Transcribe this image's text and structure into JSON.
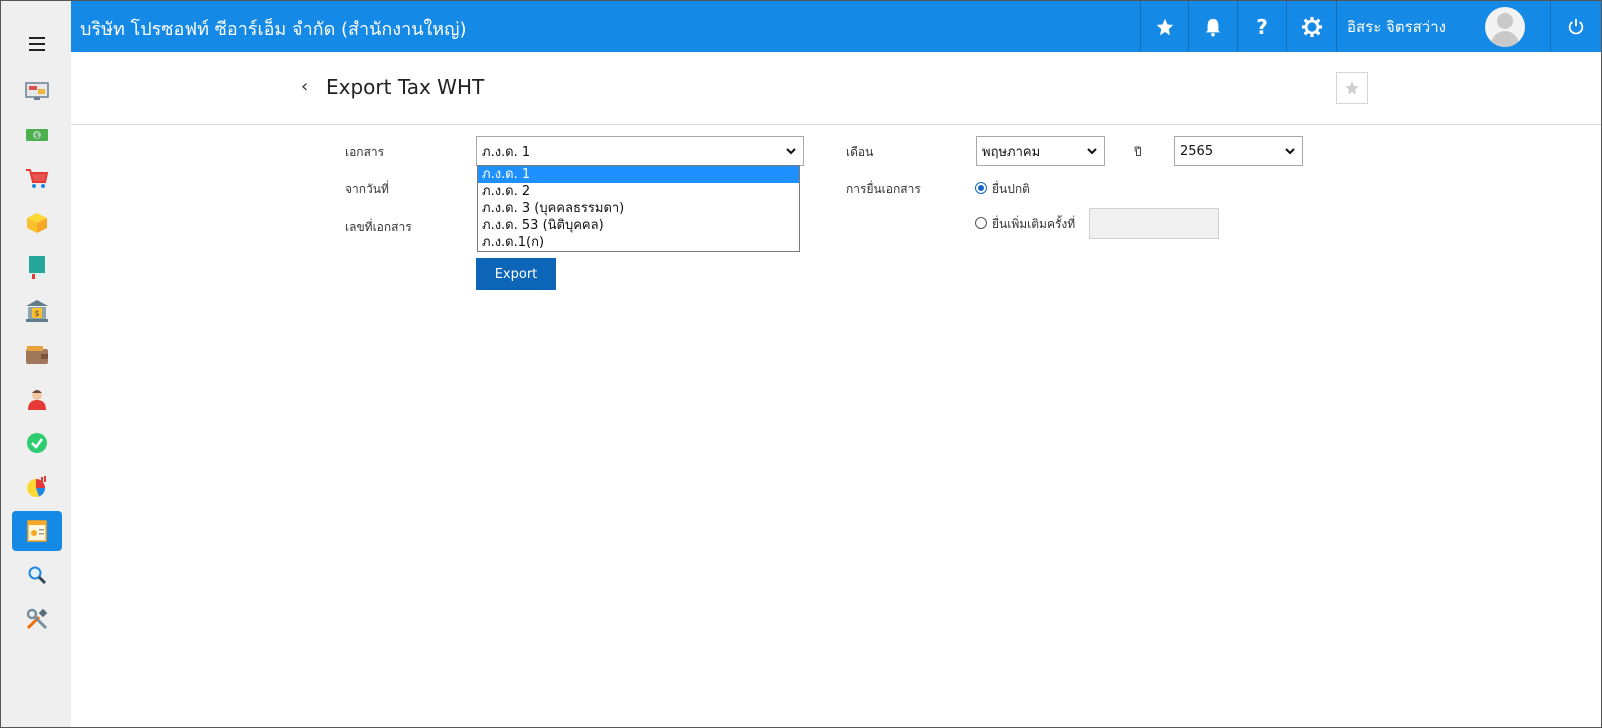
{
  "header": {
    "company": "บริษัท โปรซอฟท์ ซีอาร์เอ็ม จำกัด (สำนักงานใหญ่)",
    "user_name": "อิสระ จิตรสว่าง",
    "icons": [
      "star-icon",
      "bell-icon",
      "help-icon",
      "gear-icon",
      "avatar",
      "power-icon"
    ],
    "help_glyph": "?"
  },
  "sidebar": {
    "items": [
      {
        "icon": "monitor-icon"
      },
      {
        "icon": "money-icon"
      },
      {
        "icon": "cart-icon"
      },
      {
        "icon": "box-icon"
      },
      {
        "icon": "book-icon"
      },
      {
        "icon": "bank-icon"
      },
      {
        "icon": "wallet-icon"
      },
      {
        "icon": "person-icon"
      },
      {
        "icon": "check-icon"
      },
      {
        "icon": "pie-chart-icon"
      },
      {
        "icon": "tax-document-icon",
        "active": true
      },
      {
        "icon": "search-icon"
      },
      {
        "icon": "tools-icon"
      }
    ]
  },
  "page": {
    "back_glyph": "‹",
    "title": "Export Tax WHT"
  },
  "form": {
    "document_label": "เอกสาร",
    "document_value": "ภ.ง.ด. 1",
    "document_options": [
      "ภ.ง.ด. 1",
      "ภ.ง.ด. 2",
      "ภ.ง.ด. 3 (บุคคลธรรมดา)",
      "ภ.ง.ด. 53 (นิติบุคคล)",
      "ภ.ง.ด.1(ก)"
    ],
    "from_date_label": "จากวันที่",
    "doc_no_label": "เลขที่เอกสาร",
    "month_label": "เดือน",
    "month_value": "พฤษภาคม",
    "year_label": "ปี",
    "year_value": "2565",
    "filing_label": "การยื่นเอกสาร",
    "filing_normal": "ยื่นปกติ",
    "filing_additional": "ยื่นเพิ่มเติมครั้งที่",
    "export_button": "Export"
  },
  "colors": {
    "header_bg": "#1589e6",
    "sidebar_bg": "#efefef",
    "button_bg": "#0d65b7",
    "dropdown_selected": "#1e90ff"
  }
}
